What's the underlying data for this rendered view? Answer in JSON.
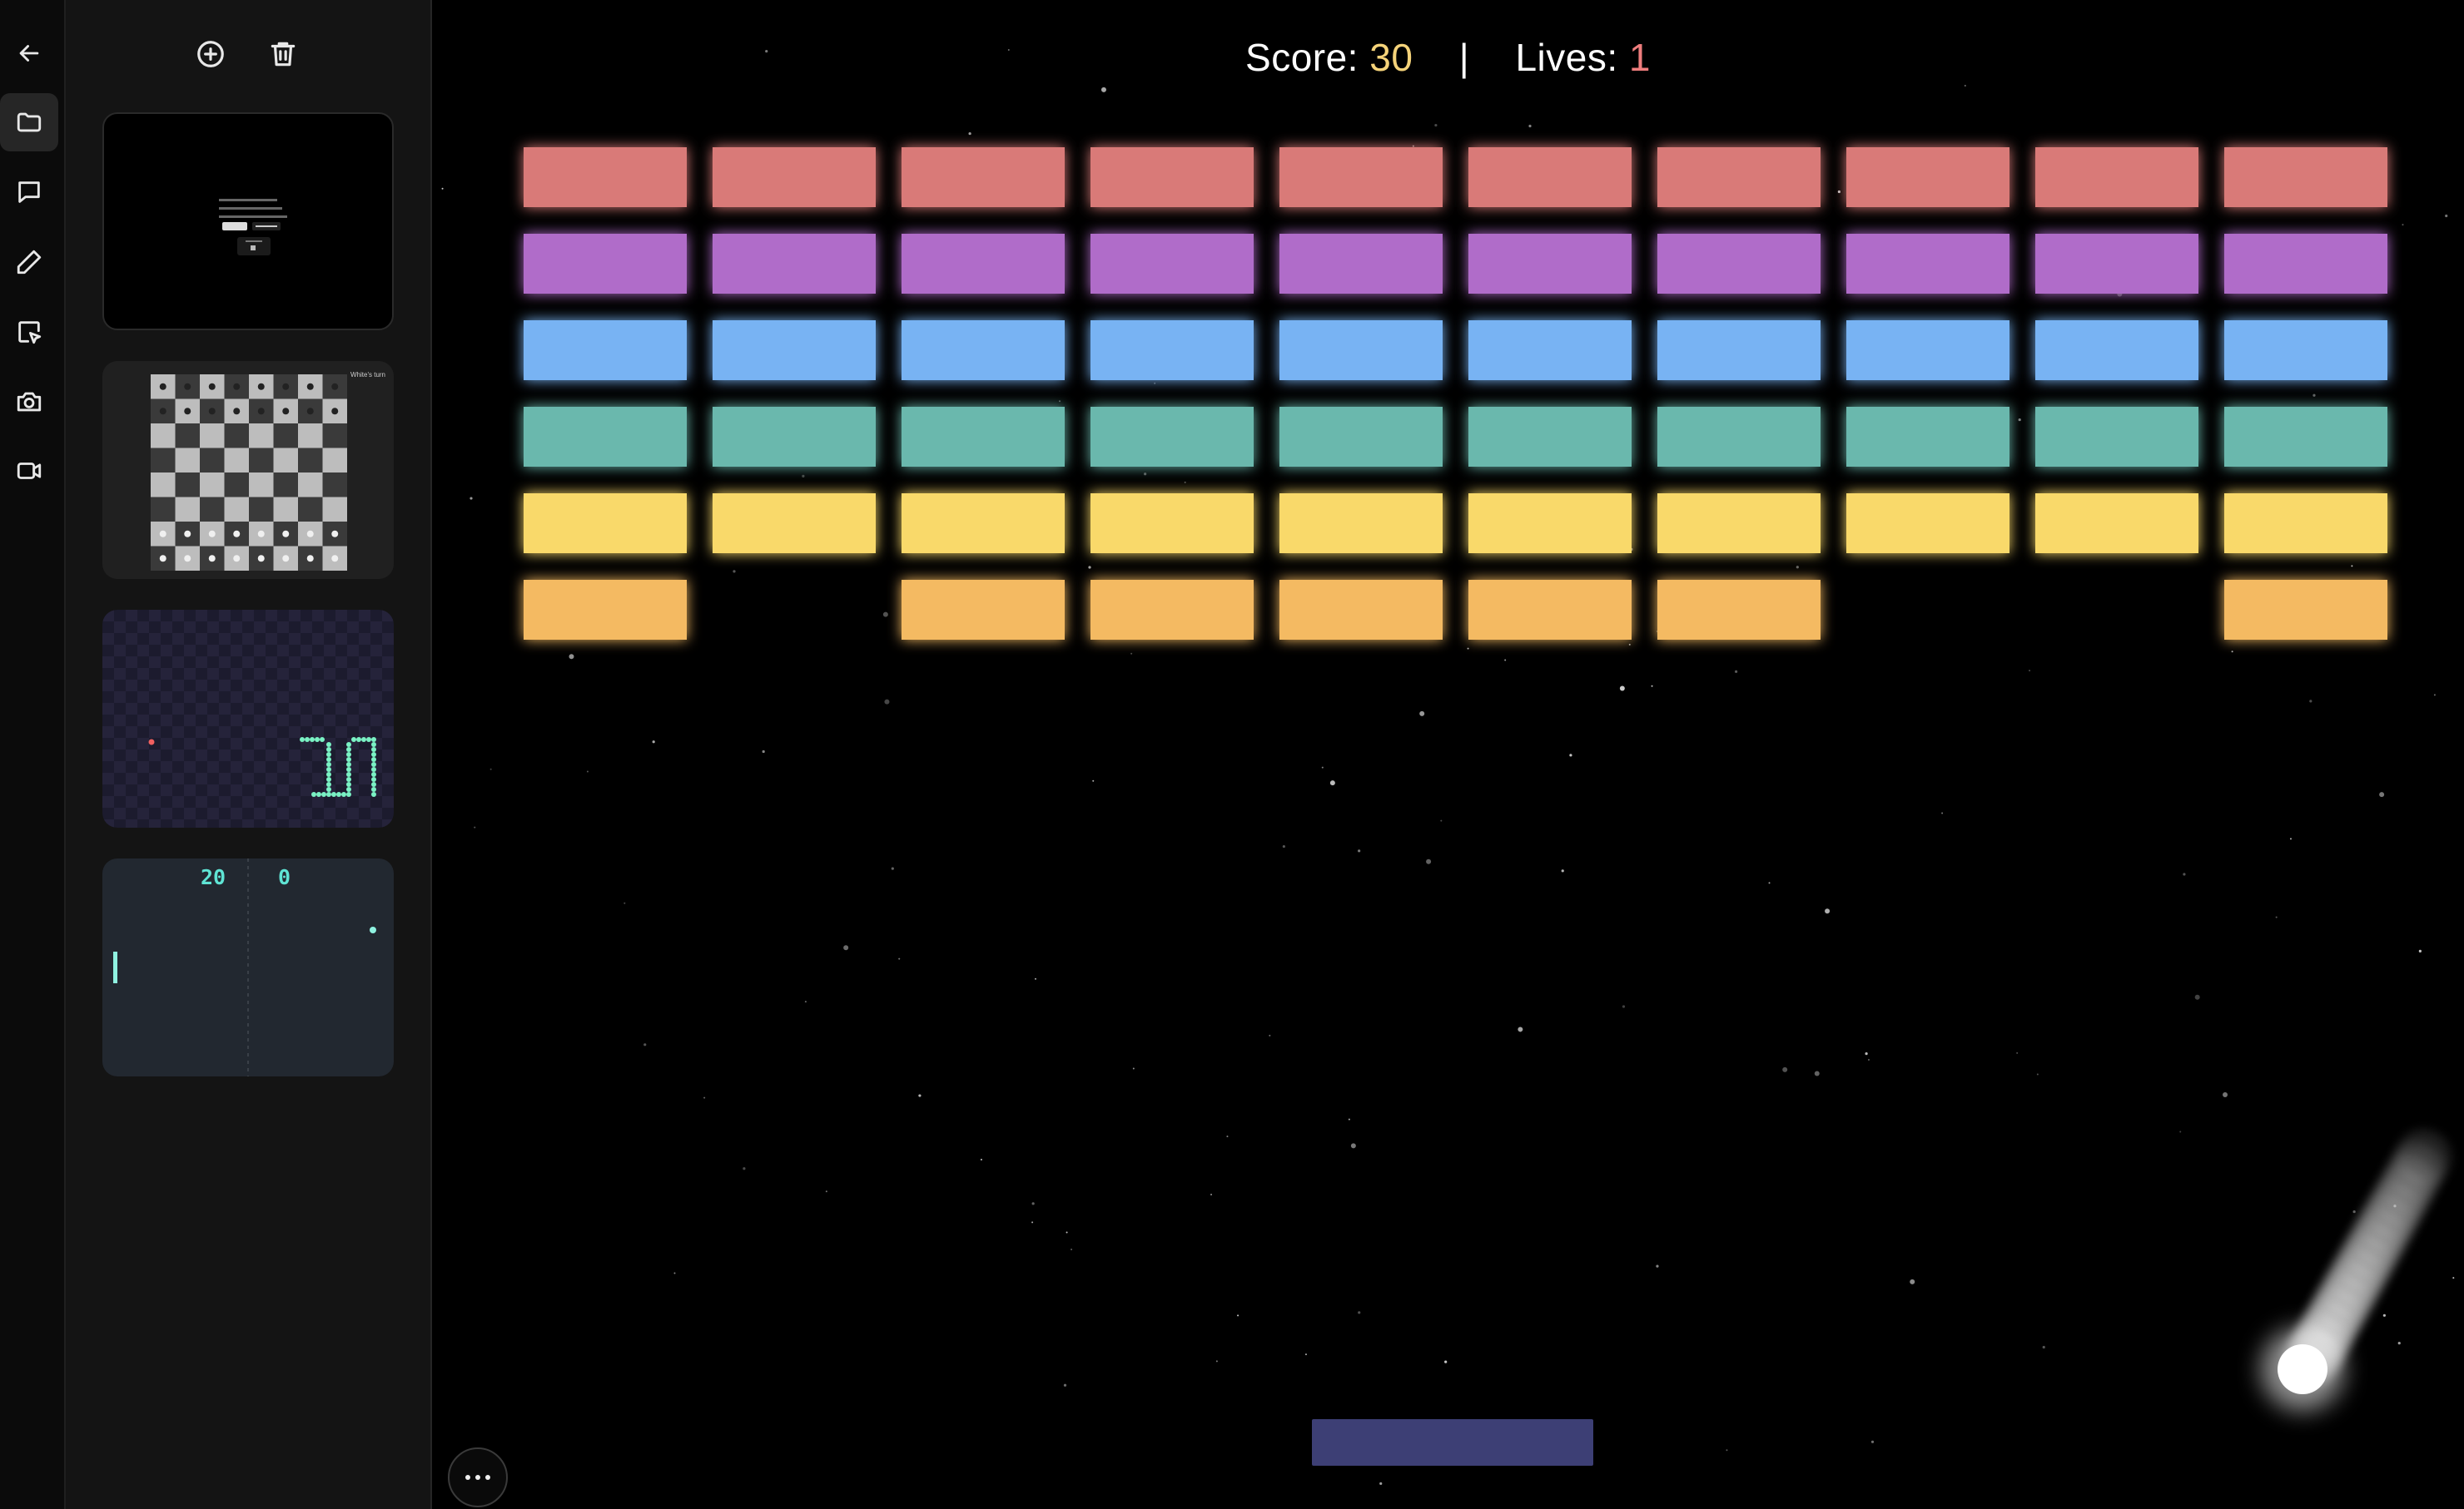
{
  "sidebar": {
    "items": [
      {
        "icon": "back-arrow-icon",
        "active": false
      },
      {
        "icon": "folder-icon",
        "active": true
      },
      {
        "icon": "chat-bubble-icon",
        "active": false
      },
      {
        "icon": "pencil-icon",
        "active": false
      },
      {
        "icon": "select-cursor-icon",
        "active": false
      },
      {
        "icon": "camera-icon",
        "active": false
      },
      {
        "icon": "video-icon",
        "active": false
      }
    ]
  },
  "panel": {
    "tools": [
      {
        "icon": "add-circle-icon"
      },
      {
        "icon": "trash-icon"
      }
    ],
    "thumbnails": [
      {
        "kind": "text-document"
      },
      {
        "kind": "chess-board",
        "caption": "White's turn"
      },
      {
        "kind": "snake-game"
      },
      {
        "kind": "pong-game",
        "left_score": "20",
        "right_score": "0"
      }
    ]
  },
  "hud": {
    "score_label": "Score:",
    "score_value": "30",
    "separator": "|",
    "lives_label": "Lives:",
    "lives_value": "1"
  },
  "colors": {
    "score_value": "#f5d37a",
    "lives_value": "#ee7d7d",
    "paddle": "#3d3f75",
    "rows": [
      "#d97a78",
      "#b06cc9",
      "#78b3f3",
      "#6ab8ad",
      "#f9d96b",
      "#f4ba62"
    ]
  },
  "bricks": {
    "columns": 10,
    "grid": [
      [
        1,
        1,
        1,
        1,
        1,
        1,
        1,
        1,
        1,
        1
      ],
      [
        1,
        1,
        1,
        1,
        1,
        1,
        1,
        1,
        1,
        1
      ],
      [
        1,
        1,
        1,
        1,
        1,
        1,
        1,
        1,
        1,
        1
      ],
      [
        1,
        1,
        1,
        1,
        1,
        1,
        1,
        1,
        1,
        1
      ],
      [
        1,
        1,
        1,
        1,
        1,
        1,
        1,
        1,
        1,
        1
      ],
      [
        1,
        0,
        1,
        1,
        1,
        1,
        1,
        0,
        0,
        1
      ]
    ]
  },
  "more_button": {
    "icon": "more-horizontal-icon"
  }
}
